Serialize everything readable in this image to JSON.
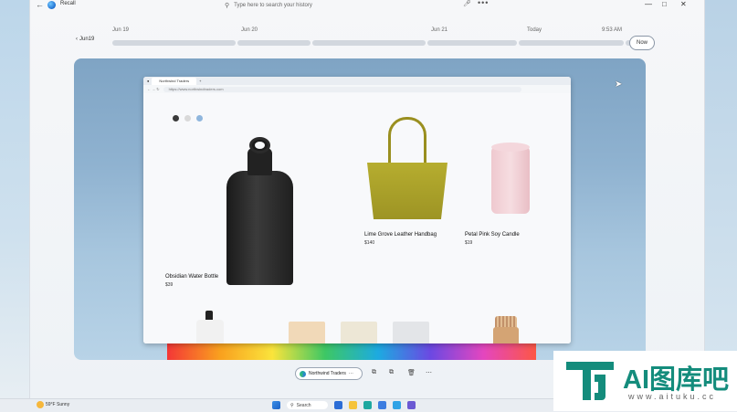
{
  "window": {
    "app_title": "Recall",
    "search_placeholder": "Type here to search your history",
    "more_glyph": "•••"
  },
  "timeline": {
    "back_label": "Jun19",
    "dates": [
      "Jun 19",
      "Jun 20",
      "Jun 21",
      "Today",
      "9:53 AM"
    ],
    "now_label": "Now"
  },
  "snapshot": {
    "browser": {
      "tab_title": "Northwind Traders",
      "url": "https://www.northwindtraders.com"
    },
    "swatch_colors": [
      "#3a3a3a",
      "#d9d9d9",
      "#8fb6dd"
    ],
    "products": [
      {
        "name": "Obsidian  Water Bottle",
        "price": "$39"
      },
      {
        "name": "Lime Grove Leather Handbag",
        "price": "$140"
      },
      {
        "name": "Petal Pink Soy Candle",
        "price": "$19"
      }
    ]
  },
  "actions": {
    "source_label": "Northwind Traders",
    "source_more": "···",
    "icons": [
      "open-icon",
      "copy-icon",
      "delete-icon",
      "more-icon"
    ]
  },
  "taskbar": {
    "weather_temp": "59°F",
    "weather_desc": "Sunny",
    "search_label": "Search"
  },
  "watermark": {
    "brand": "AI图库吧",
    "url": "www.aituku.cc"
  }
}
